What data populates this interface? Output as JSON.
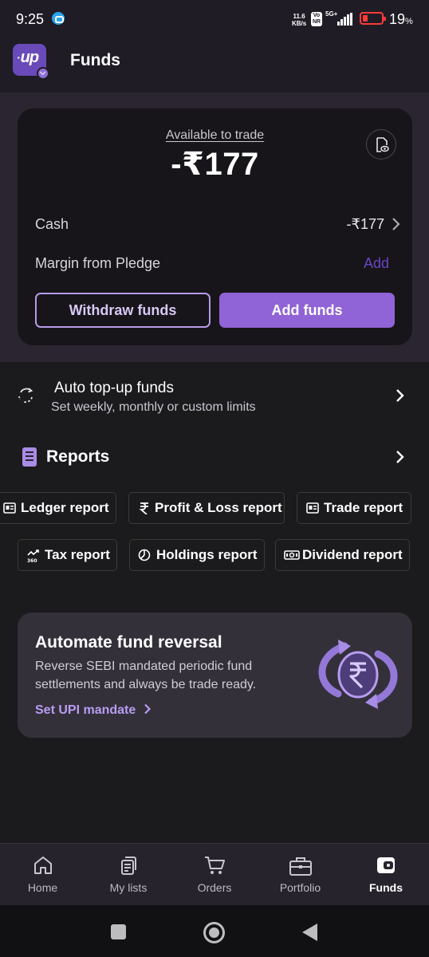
{
  "status_bar": {
    "time": "9:25",
    "net_speed_value": "11.6",
    "net_speed_unit": "KB/s",
    "volte": "Vo\nNR",
    "network": "5G+",
    "battery_percent": "19",
    "battery_unit": "%",
    "battery_level": 0.19
  },
  "app_bar": {
    "logo_text": "up",
    "title": "Funds"
  },
  "funds_card": {
    "available_label": "Available to trade",
    "available_amount": "-₹177",
    "cash_label": "Cash",
    "cash_value": "-₹177",
    "margin_label": "Margin from Pledge",
    "margin_action": "Add",
    "withdraw_label": "Withdraw funds",
    "add_funds_label": "Add funds"
  },
  "auto_topup": {
    "title": "Auto top-up funds",
    "subtitle": "Set weekly, monthly or custom limits"
  },
  "reports": {
    "title": "Reports",
    "chips": [
      {
        "label": "Ledger report",
        "icon": "ledger-icon"
      },
      {
        "label": "Profit & Loss report",
        "icon": "rupee-icon"
      },
      {
        "label": "Trade report",
        "icon": "trade-icon"
      },
      {
        "label": "Tax report",
        "icon": "tax-icon"
      },
      {
        "label": "Holdings report",
        "icon": "pie-chart-icon"
      },
      {
        "label": "Dividend report",
        "icon": "banknote-icon"
      }
    ]
  },
  "promo": {
    "title": "Automate fund reversal",
    "description": "Reverse SEBI mandated periodic fund settlements and always be trade ready.",
    "link": "Set UPI mandate"
  },
  "bottom_nav": {
    "items": [
      {
        "label": "Home",
        "icon": "home-icon"
      },
      {
        "label": "My lists",
        "icon": "lists-icon"
      },
      {
        "label": "Orders",
        "icon": "cart-icon"
      },
      {
        "label": "Portfolio",
        "icon": "briefcase-icon"
      },
      {
        "label": "Funds",
        "icon": "wallet-icon",
        "active": true
      }
    ]
  },
  "colors": {
    "background": "#1b1a1d",
    "card": "#171519",
    "accent": "#9063d6",
    "accent_text": "#b99cf0",
    "add_link": "#6a44c4"
  }
}
